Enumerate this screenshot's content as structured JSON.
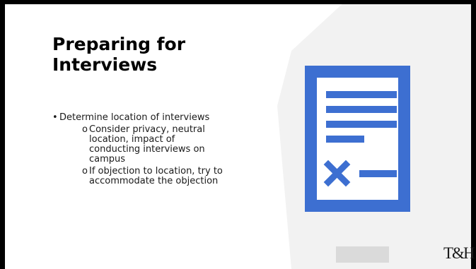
{
  "slide": {
    "title": "Preparing for Interviews",
    "bullets": [
      {
        "marker": "•",
        "text": "Determine location of interviews",
        "sub": [
          {
            "marker": "o",
            "text": "Consider privacy, neutral location, impact of conducting interviews on campus"
          },
          {
            "marker": "o",
            "text": "If objection to location, try to accommodate the objection"
          }
        ]
      }
    ],
    "icon": "document-with-x-icon",
    "logo_text": "T&H"
  },
  "colors": {
    "icon_blue": "#3D6FD1",
    "background_gray": "#F2F2F2",
    "title": "#000000"
  }
}
